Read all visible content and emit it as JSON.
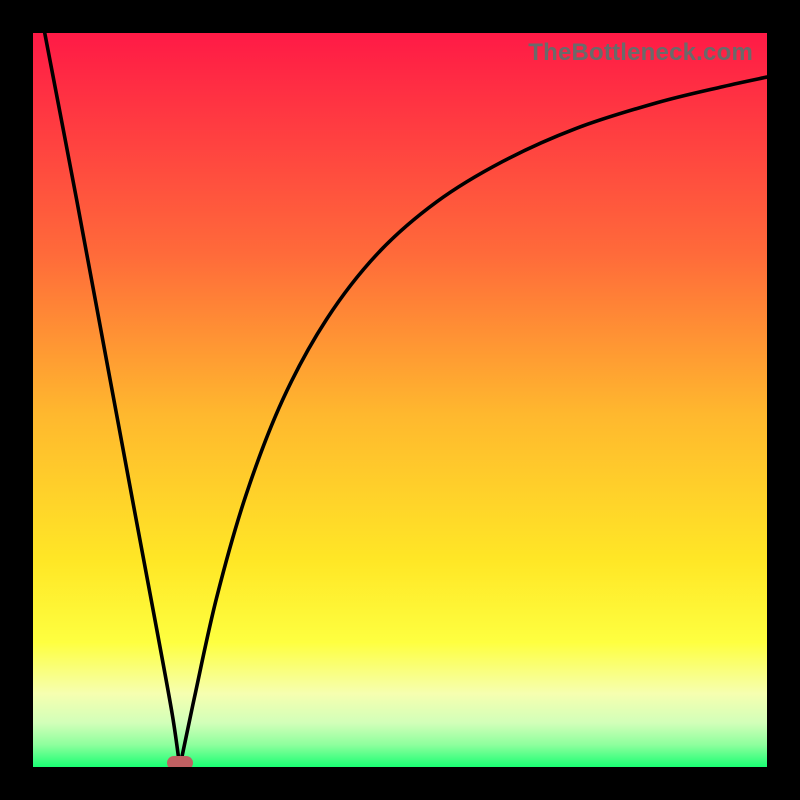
{
  "watermark": "TheBottleneck.com",
  "colors": {
    "frame": "#000000",
    "marker": "#c06062",
    "curve": "#000000",
    "gradient_stops": [
      {
        "offset": 0.0,
        "color": "#ff1a46"
      },
      {
        "offset": 0.3,
        "color": "#ff6a3a"
      },
      {
        "offset": 0.52,
        "color": "#ffb82e"
      },
      {
        "offset": 0.72,
        "color": "#ffe726"
      },
      {
        "offset": 0.83,
        "color": "#feff40"
      },
      {
        "offset": 0.9,
        "color": "#f6ffb0"
      },
      {
        "offset": 0.94,
        "color": "#d2ffb9"
      },
      {
        "offset": 0.97,
        "color": "#8dff9d"
      },
      {
        "offset": 1.0,
        "color": "#1aff73"
      }
    ]
  },
  "chart_data": {
    "type": "line",
    "title": "",
    "xlabel": "",
    "ylabel": "",
    "xlim": [
      0,
      1
    ],
    "ylim": [
      0,
      1
    ],
    "grid": false,
    "legend": false,
    "note": "Y≈1 is top (high bottleneck), Y≈0 is bottom (no bottleneck). Minimum near x≈0.20.",
    "series": [
      {
        "name": "bottleneck-left-branch",
        "x": [
          0.016,
          0.06,
          0.1,
          0.14,
          0.17,
          0.19,
          0.2
        ],
        "values": [
          1.0,
          0.77,
          0.555,
          0.34,
          0.18,
          0.07,
          0.0
        ]
      },
      {
        "name": "bottleneck-right-branch",
        "x": [
          0.2,
          0.22,
          0.25,
          0.29,
          0.34,
          0.4,
          0.47,
          0.55,
          0.64,
          0.74,
          0.85,
          0.94,
          1.0
        ],
        "values": [
          0.0,
          0.095,
          0.23,
          0.37,
          0.5,
          0.61,
          0.7,
          0.77,
          0.825,
          0.87,
          0.905,
          0.927,
          0.94
        ]
      }
    ],
    "marker": {
      "x": 0.2,
      "y": 0.005
    }
  }
}
